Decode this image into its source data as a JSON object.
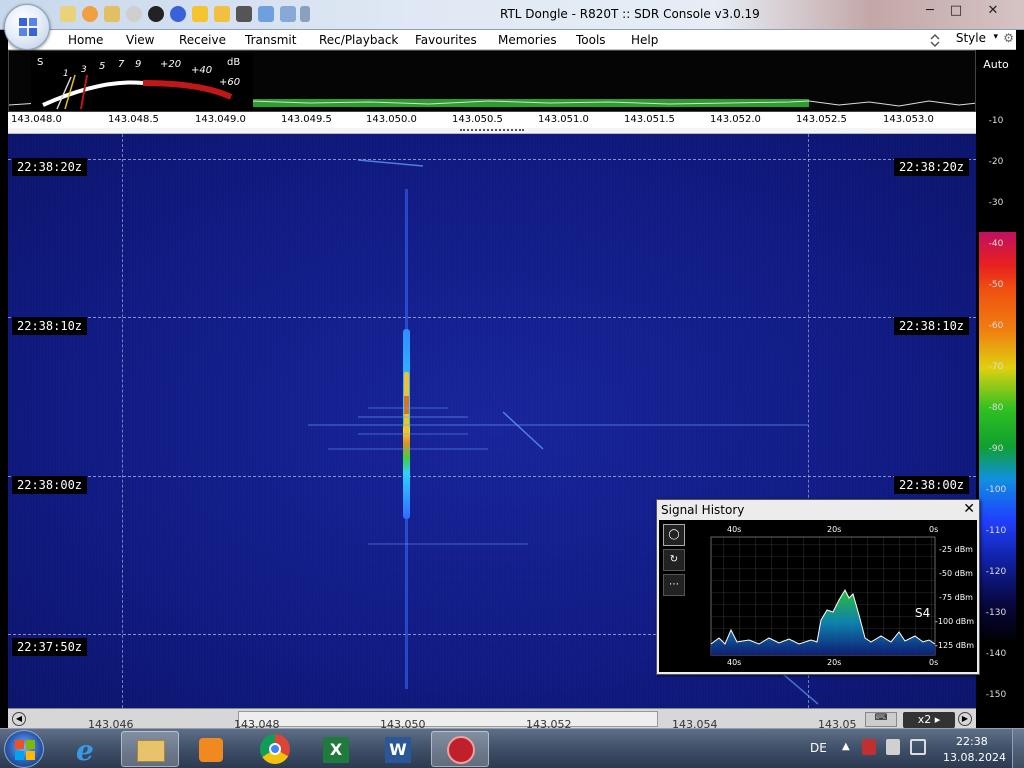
{
  "window": {
    "title": "RTL Dongle - R820T :: SDR Console v3.0.19",
    "minimize": "─",
    "maximize": "□",
    "close": "✕"
  },
  "menu": {
    "items": [
      "Home",
      "View",
      "Receive",
      "Transmit",
      "Rec/Playback",
      "Favourites",
      "Memories",
      "Tools",
      "Help"
    ],
    "style_label": "Style"
  },
  "smeter": {
    "unit_s": "S",
    "unit_db": "dB",
    "scale": [
      "1",
      "3",
      "5",
      "7",
      "9",
      "+20",
      "+40",
      "+60"
    ]
  },
  "freq_scale": [
    "143.048.0",
    "143.048.5",
    "143.049.0",
    "143.049.5",
    "143.050.0",
    "143.050.5",
    "143.051.0",
    "143.051.5",
    "143.052.0",
    "143.052.5",
    "143.053.0"
  ],
  "db_scale": {
    "auto_label": "Auto",
    "labels": [
      "-10",
      "-20",
      "-30",
      "-40",
      "-50",
      "-60",
      "-70",
      "-80",
      "-90",
      "-100",
      "-110",
      "-120",
      "-130",
      "-140",
      "-150"
    ]
  },
  "waterfall": {
    "time_tags": [
      "22:38:20z",
      "22:38:10z",
      "22:38:00z",
      "22:37:50z"
    ]
  },
  "bottom_scale": [
    "143.046",
    "143.048",
    "143.050",
    "143.052",
    "143.054",
    "143.05"
  ],
  "zoom_label": "x2",
  "signal_history": {
    "title": "Signal History",
    "close": "✕",
    "time_labels": [
      "40s",
      "20s",
      "0s"
    ],
    "dbm_labels": [
      "-25 dBm",
      "-50 dBm",
      "-75 dBm",
      "-100 dBm",
      "-125 dBm"
    ],
    "s_reading": "S4"
  },
  "taskbar": {
    "language": "DE",
    "time": "22:38",
    "date": "13.08.2024"
  }
}
